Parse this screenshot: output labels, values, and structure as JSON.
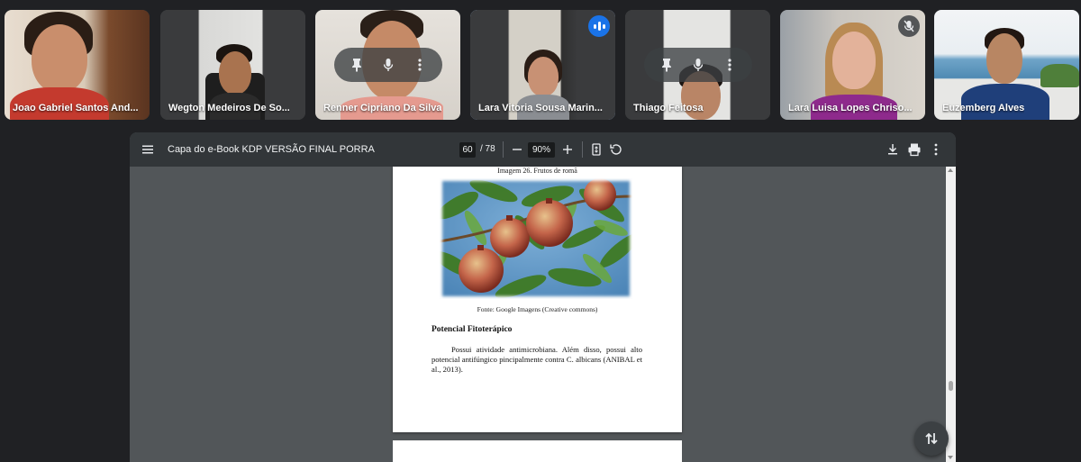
{
  "participants": [
    {
      "name": "Joao Gabriel Santos And..."
    },
    {
      "name": "Wegton Medeiros De So..."
    },
    {
      "name": "Renner Cipriano Da Silva"
    },
    {
      "name": "Lara Vitoria Sousa Marin..."
    },
    {
      "name": "Thiago Feitosa"
    },
    {
      "name": "Lara Luisa Lopes Chriso..."
    },
    {
      "name": "Euzemberg Alves"
    }
  ],
  "viewer": {
    "title": "Capa do e-Book KDP VERSÃO FINAL PORRA",
    "current_page": "60",
    "page_total": "/ 78",
    "zoom": "90%"
  },
  "document": {
    "figure_caption": "Imagem 26. Frutos de romã",
    "figure_source": "Fonte: Google Imagens (Creative commons)",
    "section_title": "Potencial Fitoterápico",
    "paragraph": "Possui atividade antimicrobiana. Além disso, possui alto potencial antifúngico pincipalmente contra C. albicans (ANIBAL et al., 2013)."
  },
  "icons": {
    "menu": "hamburger-menu-icon",
    "download": "download-icon",
    "print": "print-icon",
    "more": "more-vert-icon",
    "fit": "fit-page-icon",
    "rotate": "rotate-icon",
    "pin": "pin-icon",
    "mic": "mic-icon",
    "mic_off": "mic-off-icon",
    "speaking": "speaking-indicator-icon",
    "fab": "swap-vertical-icon"
  },
  "colors": {
    "background": "#202124",
    "toolbar": "#323639",
    "viewer_bg": "#525659",
    "active_border": "#a8c7fa",
    "speaking": "#1a73e8"
  }
}
